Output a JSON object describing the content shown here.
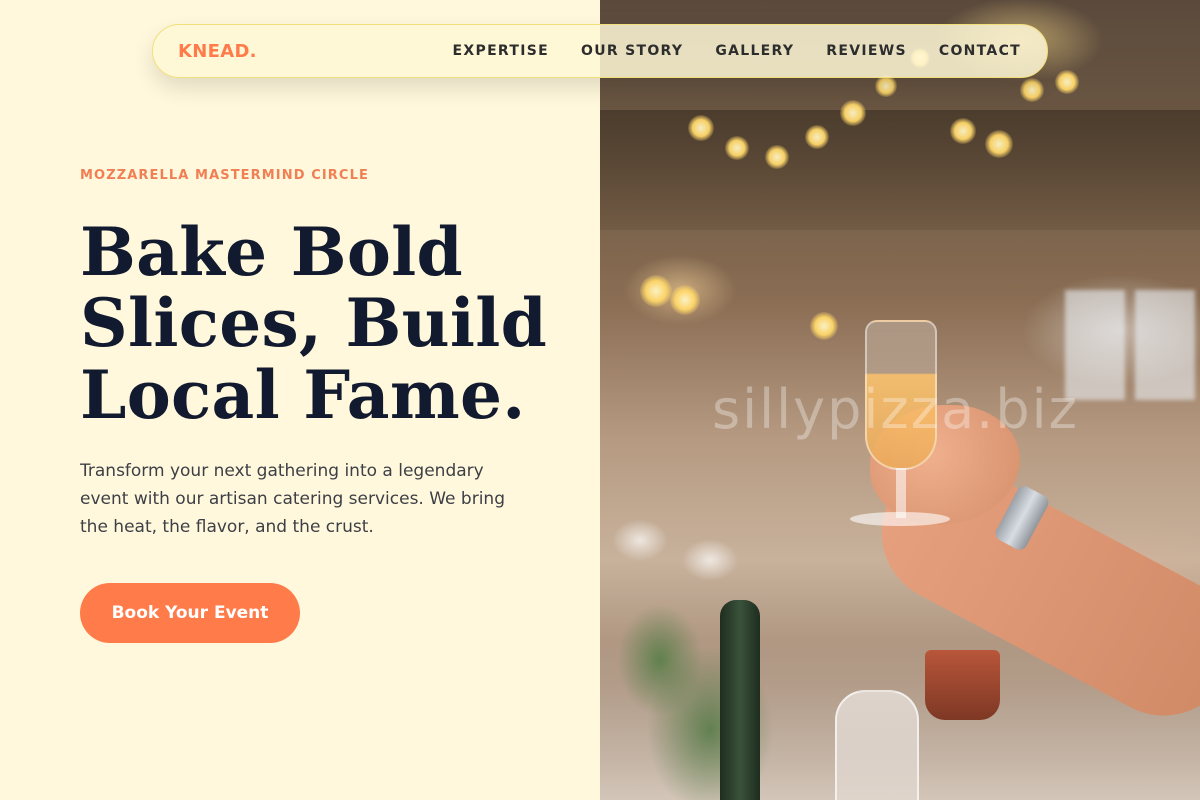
{
  "brand": {
    "logo": "KNEAD."
  },
  "nav": {
    "items": [
      {
        "label": "EXPERTISE"
      },
      {
        "label": "OUR STORY"
      },
      {
        "label": "GALLERY"
      },
      {
        "label": "REVIEWS"
      },
      {
        "label": "CONTACT"
      }
    ]
  },
  "hero": {
    "eyebrow": "MOZZARELLA MASTERMIND CIRCLE",
    "headline_lines": [
      "Bake Bold",
      "Slices, Build",
      "Local Fame."
    ],
    "subtext": "Transform your next gathering into a legendary event with our artisan catering services. We bring the heat, the flavor, and the crust.",
    "cta_label": "Book Your Event"
  },
  "image": {
    "watermark": "sillypizza.biz"
  },
  "colors": {
    "background": "#fff8dc",
    "accent": "#ff7b4a",
    "headline": "#111a2e"
  }
}
